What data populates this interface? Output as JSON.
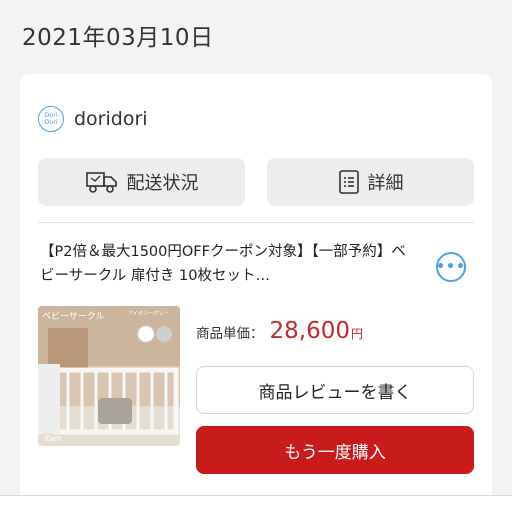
{
  "order": {
    "date": "2021年03月10日"
  },
  "shop": {
    "logo_text": "Dori Dori",
    "name": "doridori"
  },
  "actions": {
    "shipping_status_label": "配送状況",
    "details_label": "詳細"
  },
  "item": {
    "title": "【P2倍＆最大1500円OFFクーポン対象】【一部予約】ベビーサークル 扉付き 10枚セット…",
    "thumbnail_label": "ベビーサークル",
    "thumbnail_sub": "アイボリー/グレー",
    "thumbnail_brand": "ifam",
    "price_label": "商品単価：",
    "price_value": "28,600",
    "price_unit": "円",
    "more_icon": "ellipsis-icon"
  },
  "buttons": {
    "review_label": "商品レビューを書く",
    "rebuy_label": "もう一度購入"
  },
  "colors": {
    "accent_blue": "#4aa3df",
    "price_red": "#c02a2a",
    "rebuy_red": "#c81b1b"
  }
}
